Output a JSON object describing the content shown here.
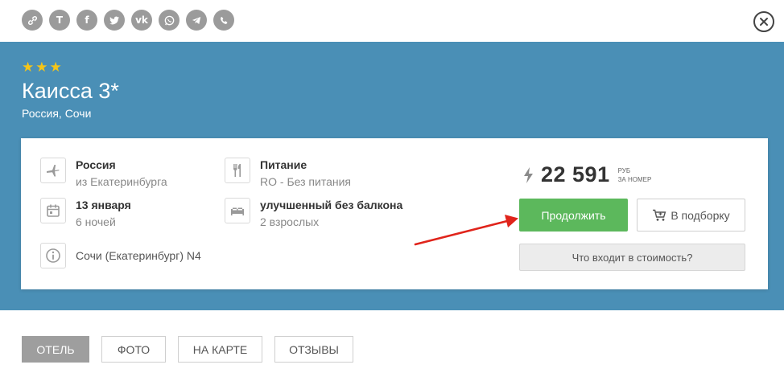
{
  "share": {
    "icons": [
      "link-icon",
      "t-icon",
      "facebook-icon",
      "twitter-icon",
      "vk-icon",
      "whatsapp-icon",
      "telegram-icon",
      "viber-icon"
    ],
    "t_label": "T",
    "f_label": "f",
    "vk_label": "vk"
  },
  "hotel": {
    "stars": 3,
    "name": "Каисса 3*",
    "location": "Россия, Сочи"
  },
  "details": {
    "country_title": "Россия",
    "country_sub": "из Екатеринбурга",
    "date_title": "13 января",
    "date_sub": "6 ночей",
    "info_text": "Сочи (Екатеринбург) N4",
    "meal_title": "Питание",
    "meal_sub": "RO - Без питания",
    "room_title": "улучшенный без балкона",
    "room_sub": "2 взрослых"
  },
  "price": {
    "amount": "22 591",
    "currency": "РУБ",
    "per": "ЗА НОМЕР"
  },
  "buttons": {
    "continue": "Продолжить",
    "collection": "В подборку",
    "cost": "Что входит в стоимость?"
  },
  "tabs": [
    {
      "label": "Отель",
      "active": true
    },
    {
      "label": "Фото",
      "active": false
    },
    {
      "label": "На карте",
      "active": false
    },
    {
      "label": "Отзывы",
      "active": false
    }
  ],
  "colors": {
    "header_blue": "#4a8fb6",
    "accent_green": "#5cb85c",
    "star_yellow": "#f5c518",
    "arrow_red": "#e0241b"
  }
}
